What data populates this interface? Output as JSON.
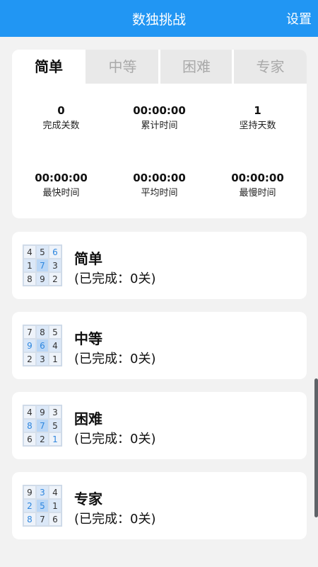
{
  "header": {
    "title": "数独挑战",
    "settings_label": "设置"
  },
  "tabs": [
    {
      "label": "简单",
      "active": true
    },
    {
      "label": "中等",
      "active": false
    },
    {
      "label": "困难",
      "active": false
    },
    {
      "label": "专家",
      "active": false
    }
  ],
  "stats": [
    {
      "value": "0",
      "label": "完成关数"
    },
    {
      "value": "00:00:00",
      "label": "累计时间"
    },
    {
      "value": "1",
      "label": "坚持天数"
    },
    {
      "value": "00:00:00",
      "label": "最快时间"
    },
    {
      "value": "00:00:00",
      "label": "平均时间"
    },
    {
      "value": "00:00:00",
      "label": "最慢时间"
    }
  ],
  "levels": [
    {
      "name": "简单",
      "status": "(已完成：0关)",
      "grid": [
        "4",
        "5",
        "6",
        "1",
        "7",
        "3",
        "8",
        "9",
        "2"
      ],
      "blue_cells": [
        2,
        4
      ],
      "highlight_row": 1,
      "highlight_col": 1
    },
    {
      "name": "中等",
      "status": "(已完成：0关)",
      "grid": [
        "7",
        "8",
        "5",
        "9",
        "6",
        "4",
        "2",
        "3",
        "1"
      ],
      "blue_cells": [
        3,
        4
      ],
      "highlight_row": 1,
      "highlight_col": 1
    },
    {
      "name": "困难",
      "status": "(已完成：0关)",
      "grid": [
        "4",
        "9",
        "3",
        "8",
        "7",
        "5",
        "6",
        "2",
        "1"
      ],
      "blue_cells": [
        3,
        4,
        8
      ],
      "highlight_row": 1,
      "highlight_col": 1
    },
    {
      "name": "专家",
      "status": "(已完成：0关)",
      "grid": [
        "9",
        "3",
        "4",
        "2",
        "5",
        "1",
        "8",
        "7",
        "6"
      ],
      "blue_cells": [
        1,
        3,
        4,
        6
      ],
      "highlight_row": 1,
      "highlight_col": 1
    }
  ],
  "colors": {
    "accent": "#2196f3",
    "background": "#f2f2f2",
    "number_blue": "#2e86de"
  }
}
